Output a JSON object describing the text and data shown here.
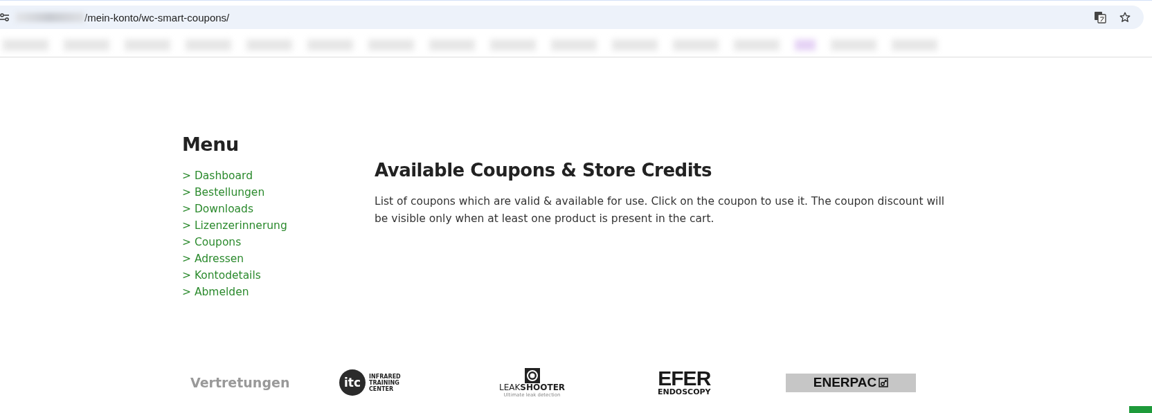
{
  "browser": {
    "url": "/mein-konto/wc-smart-coupons/"
  },
  "menu": {
    "title": "Menu",
    "items": [
      {
        "label": "> Dashboard"
      },
      {
        "label": "> Bestellungen"
      },
      {
        "label": "> Downloads"
      },
      {
        "label": "> Lizenzerinnerung"
      },
      {
        "label": "> Coupons"
      },
      {
        "label": "> Adressen"
      },
      {
        "label": "> Kontodetails"
      },
      {
        "label": "> Abmelden"
      }
    ]
  },
  "content": {
    "title": "Available Coupons & Store Credits",
    "text": "List of coupons which are valid & available for use. Click on the coupon to use it. The coupon discount will be visible only when at least one product is present in the cart."
  },
  "footer": {
    "heading": "Vertretungen",
    "logos": [
      {
        "kind": "itc",
        "badge": "itc",
        "lines": [
          "INFRARED",
          "TRAINING",
          "CENTER"
        ]
      },
      {
        "kind": "leakshooter",
        "lines": [
          "LEAK",
          "SHOOTER",
          "Ultimate leak detection"
        ]
      },
      {
        "kind": "efer",
        "lines": [
          "EFER",
          "ENDOSCOPY"
        ]
      },
      {
        "kind": "enerpac",
        "lines": [
          "ENERPAC"
        ]
      }
    ]
  }
}
